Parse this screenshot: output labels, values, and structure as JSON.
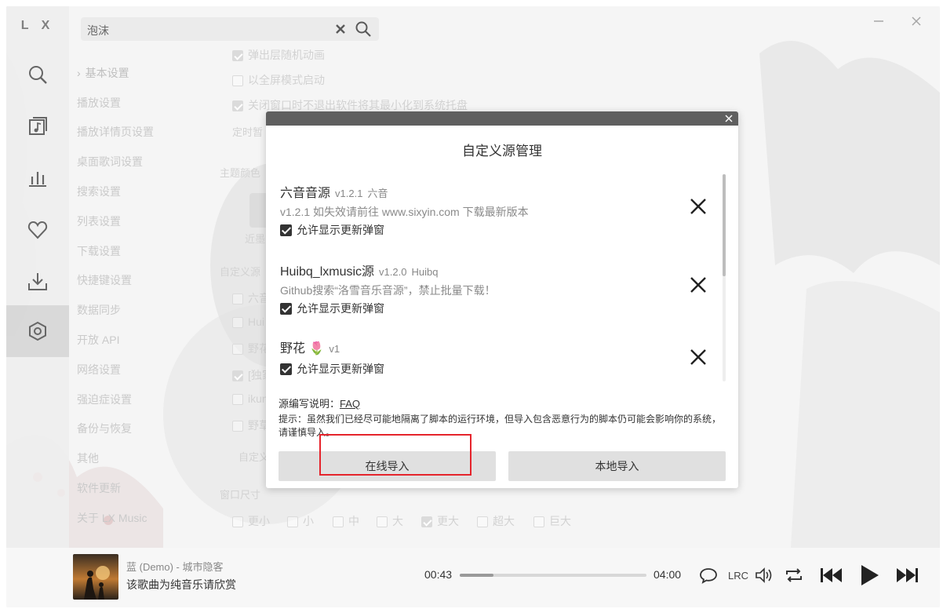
{
  "app": {
    "logo": "L X"
  },
  "search": {
    "query": "泡沫"
  },
  "settings_nav": [
    "基本设置",
    "播放设置",
    "播放详情页设置",
    "桌面歌词设置",
    "搜索设置",
    "列表设置",
    "下载设置",
    "快捷键设置",
    "数据同步",
    "开放 API",
    "网络设置",
    "强迫症设置",
    "备份与恢复",
    "其他",
    "软件更新",
    "关于 LX Music"
  ],
  "settings_content": {
    "popup_anim": "弹出层随机动画",
    "fullscreen": "以全屏模式启动",
    "tray": "关闭窗口时不退出软件将其最小化到系统托盘",
    "timer": "定时暂",
    "theme_label": "主题颜色",
    "theme_near": "近墨",
    "custom_source_label": "自定义源",
    "sources": [
      "六音",
      "Hui",
      "野花",
      "[独家",
      "ikun",
      "野草"
    ],
    "custom_btn": "自定义",
    "window_size_label": "窗口尺寸",
    "sizes": [
      "更小",
      "小",
      "中",
      "大",
      "更大",
      "超大",
      "巨大"
    ],
    "selected_size": "更大"
  },
  "modal": {
    "title": "自定义源管理",
    "sources": [
      {
        "name": "六音音源",
        "version": "v1.2.1",
        "author": "六音",
        "desc": "v1.2.1 如失效请前往 www.sixyin.com 下载最新版本",
        "option": "允许显示更新弹窗"
      },
      {
        "name": "Huibq_lxmusic源",
        "version": "v1.2.0",
        "author": "Huibq",
        "desc": "Github搜索“洛雪音乐音源”，禁止批量下载！",
        "option": "允许显示更新弹窗"
      },
      {
        "name": "野花 🌷",
        "version": "v1",
        "author": "",
        "desc": "",
        "option": "允许显示更新弹窗"
      }
    ],
    "doc_label": "源编写说明：",
    "doc_link": "FAQ",
    "tip": "提示：虽然我们已经尽可能地隔离了脚本的运行环境，但导入包含恶意行为的脚本仍可能会影响你的系统，请谨慎导入。",
    "btn_online": "在线导入",
    "btn_local": "本地导入"
  },
  "player": {
    "title": "蓝 (Demo) - 城市隐客",
    "subtitle": "该歌曲为纯音乐请欣赏",
    "time_current": "00:43",
    "time_total": "04:00",
    "progress": 0.18,
    "lrc": "LRC"
  }
}
